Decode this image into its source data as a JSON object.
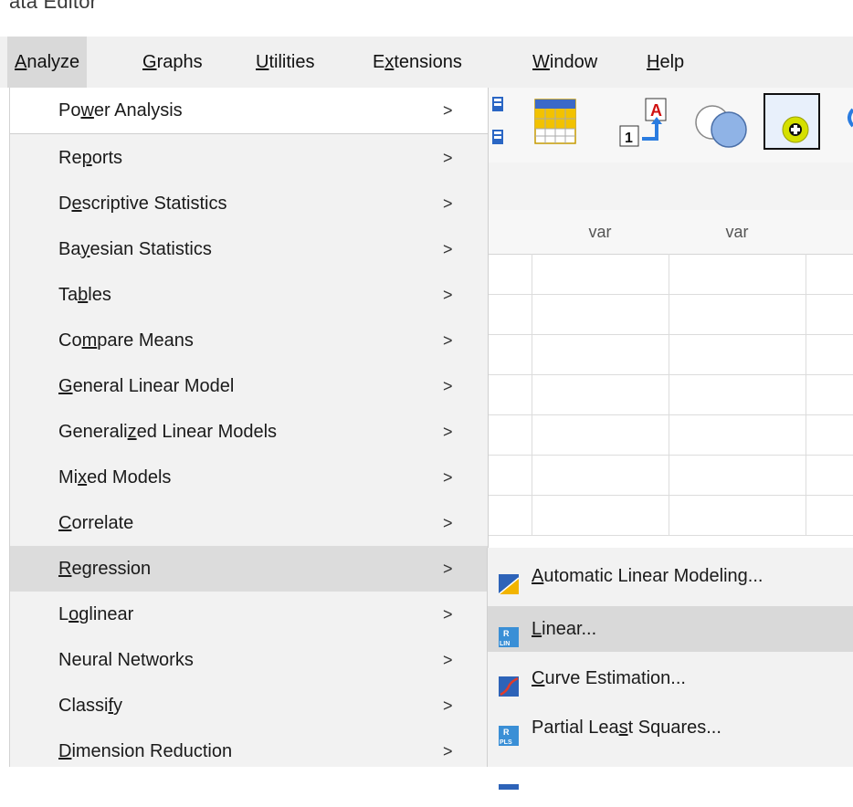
{
  "window": {
    "title_fragment": "ata Editor"
  },
  "menubar": [
    {
      "label": "Analyze",
      "underline": "A",
      "active": true
    },
    {
      "label": "Graphs",
      "underline": "G",
      "active": false
    },
    {
      "label": "Utilities",
      "underline": "U",
      "active": false
    },
    {
      "label": "Extensions",
      "underline": "x",
      "active": false
    },
    {
      "label": "Window",
      "underline": "W",
      "active": false
    },
    {
      "label": "Help",
      "underline": "H",
      "active": false
    }
  ],
  "toolbar": {
    "icons": [
      "grid-icon",
      "chart-table-icon",
      "sort-by-label-icon",
      "venn-circles-icon",
      "add-variable-icon"
    ]
  },
  "sheet": {
    "column_headers": [
      "var",
      "var"
    ]
  },
  "analyze_menu": [
    {
      "label": "Power Analysis",
      "arrow": ">"
    },
    {
      "label": "Reports",
      "arrow": ">"
    },
    {
      "label": "Descriptive Statistics",
      "arrow": ">"
    },
    {
      "label": "Bayesian Statistics",
      "arrow": ">"
    },
    {
      "label": "Tables",
      "arrow": ">"
    },
    {
      "label": "Compare Means",
      "arrow": ">"
    },
    {
      "label": "General Linear Model",
      "arrow": ">"
    },
    {
      "label": "Generalized Linear Models",
      "arrow": ">"
    },
    {
      "label": "Mixed Models",
      "arrow": ">"
    },
    {
      "label": "Correlate",
      "arrow": ">"
    },
    {
      "label": "Regression",
      "arrow": ">"
    },
    {
      "label": "Loglinear",
      "arrow": ">"
    },
    {
      "label": "Neural Networks",
      "arrow": ">"
    },
    {
      "label": "Classify",
      "arrow": ">"
    },
    {
      "label": "Dimension Reduction",
      "arrow": ">"
    }
  ],
  "regression_submenu": [
    {
      "label": "Automatic Linear Modeling...",
      "icon": "automatic-linear-modeling-icon"
    },
    {
      "label": "Linear...",
      "icon": "linear-regression-icon"
    },
    {
      "label": "Curve Estimation...",
      "icon": "curve-estimation-icon"
    },
    {
      "label": "Partial Least Squares...",
      "icon": "partial-least-squares-icon"
    }
  ],
  "colors": {
    "menubar_bg": "#f0f0f0",
    "menu_bg": "#f2f2f2",
    "highlight": "#dcdcdc",
    "toolbar_bg": "#f7f7f7"
  }
}
